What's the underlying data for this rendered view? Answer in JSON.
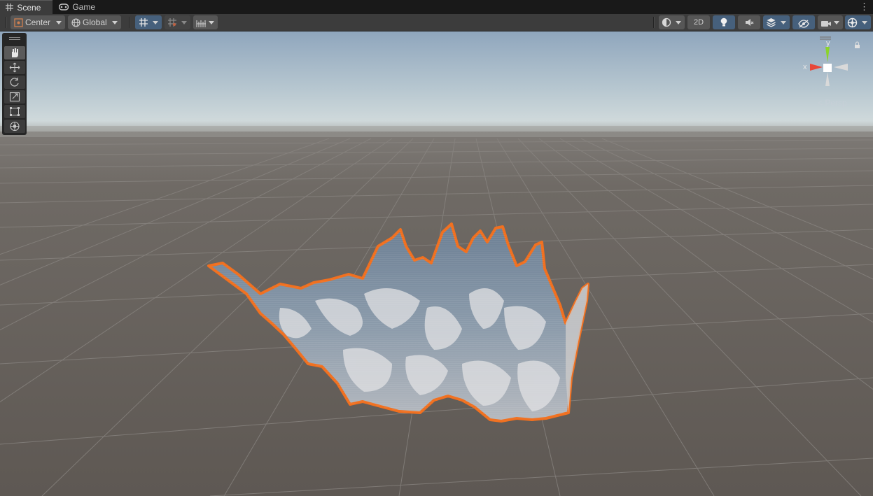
{
  "tabs": [
    {
      "label": "Scene",
      "icon": "grid-icon",
      "active": true
    },
    {
      "label": "Game",
      "icon": "gamepad-icon",
      "active": false
    }
  ],
  "toolbar": {
    "pivot_mode": "Center",
    "pivot_rotation": "Global",
    "view_2d": "2D"
  },
  "tools": [
    "hand-tool",
    "move-tool",
    "rotate-tool",
    "scale-tool",
    "rect-tool",
    "transform-tool"
  ],
  "gizmo": {
    "x_label": "x",
    "y_label": "y",
    "projection": "Persp"
  },
  "colors": {
    "selection_outline": "#f07020",
    "mesh": "#7a8a9c",
    "ground": "#625c57",
    "sky_top": "#8fa6bd"
  }
}
